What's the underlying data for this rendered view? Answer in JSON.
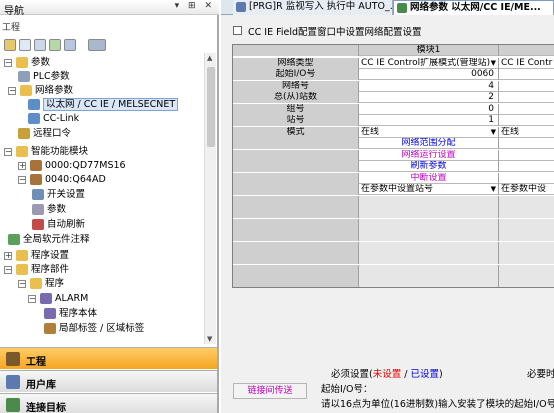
{
  "nav": {
    "title": "导航",
    "window_buttons": "▾ ⊞ ✕",
    "project_label": "工程",
    "tree": [
      {
        "label": "参数",
        "icon": "folder-icon",
        "expander": "⊟"
      },
      {
        "label": "PLC参数",
        "icon": "gear-icon"
      },
      {
        "label": "网络参数",
        "icon": "folder-icon",
        "expander": "⊟"
      },
      {
        "label": "以太网 / CC IE / MELSECNET",
        "icon": "network-icon"
      },
      {
        "label": "CC-Link",
        "icon": "network-icon"
      },
      {
        "label": "远程口令",
        "icon": "key-icon"
      },
      {
        "label": "智能功能模块",
        "icon": "folder-icon",
        "expander": "⊟"
      },
      {
        "label": "0000:QD77MS16",
        "icon": "module-icon",
        "expander": "⊞"
      },
      {
        "label": "0040:Q64AD",
        "icon": "module-icon",
        "expander": "⊟"
      },
      {
        "label": "开关设置",
        "icon": "switch-icon"
      },
      {
        "label": "参数",
        "icon": "param-icon"
      },
      {
        "label": "自动刷新",
        "icon": "refresh-icon"
      },
      {
        "label": "全局软元件注释",
        "icon": "comment-icon"
      },
      {
        "label": "程序设置",
        "icon": "folder-icon",
        "expander": "⊞"
      },
      {
        "label": "程序部件",
        "icon": "folder-icon",
        "expander": "⊟"
      },
      {
        "label": "程序",
        "icon": "folder-icon",
        "expander": "⊟"
      },
      {
        "label": "ALARM",
        "icon": "program-icon",
        "expander": "⊟"
      },
      {
        "label": "程序本体",
        "icon": "program-icon"
      },
      {
        "label": "局部标签 / 区域标签",
        "icon": "label-icon"
      }
    ],
    "bottom_tabs": [
      {
        "label": "工程",
        "icon": "project-icon"
      },
      {
        "label": "用户库",
        "icon": "library-icon"
      },
      {
        "label": "连接目标",
        "icon": "connection-icon"
      }
    ]
  },
  "tabs": [
    {
      "label": "[PRG]R 监视写入 执行中 AUTO_...",
      "icon": "program-icon"
    },
    {
      "label": "网络参数 以太网/CC IE/ME...",
      "icon": "network-icon"
    }
  ],
  "cc_checkbox": "CC IE Field配置窗口中设置网络配置设置",
  "grid": {
    "module_header": "模块1",
    "rows": [
      {
        "label": "网络类型",
        "value": "CC IE Control扩展模式(管理站)",
        "value2": "CC IE Contr",
        "kind": "dropdown"
      },
      {
        "label": "起始I/O号",
        "value": "0060",
        "kind": "number"
      },
      {
        "label": "网络号",
        "value": "4",
        "kind": "number"
      },
      {
        "label": "总(从)站数",
        "value": "2",
        "kind": "number"
      },
      {
        "label": "组号",
        "value": "0",
        "kind": "number"
      },
      {
        "label": "站号",
        "value": "1",
        "kind": "number"
      },
      {
        "label": "模式",
        "value": "在线",
        "value2": "在线",
        "kind": "dropdown"
      },
      {
        "label": "",
        "value": "网络范围分配",
        "color": "#0000e0",
        "kind": "button"
      },
      {
        "label": "",
        "value": "网络运行设置",
        "color": "#c000c0",
        "kind": "button"
      },
      {
        "label": "",
        "value": "刷新参数",
        "color": "#0000e0",
        "kind": "button"
      },
      {
        "label": "",
        "value": "中断设置",
        "color": "#c000c0",
        "kind": "button"
      },
      {
        "label": "",
        "value": "在参数中设置站号",
        "value2": "在参数中设",
        "kind": "dropdown"
      }
    ]
  },
  "required_legend": {
    "prefix": "必须设置(",
    "not_set": "未设置",
    "sep": " / ",
    "set": "已设置",
    "suffix": ")",
    "right_cut": "必要时"
  },
  "link_button": "链接间传送",
  "help": {
    "line1": "起始I/O号：",
    "line2": "请以16点为单位(16进制数)输入安装了模块的起始I/O号。"
  }
}
